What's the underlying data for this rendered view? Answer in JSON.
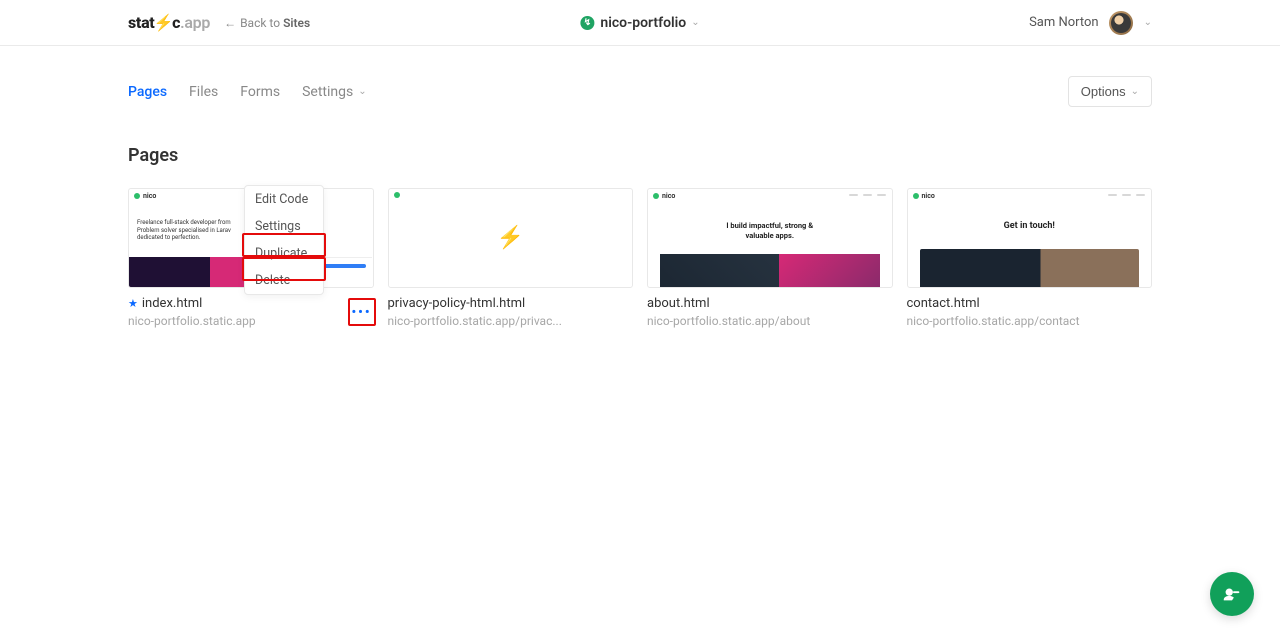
{
  "header": {
    "logo_prefix": "stat",
    "logo_suffix": "c",
    "logo_app": ".app",
    "back_prefix": "Back to",
    "back_target": "Sites",
    "site_name": "nico-portfolio",
    "user_name": "Sam Norton"
  },
  "tabs": {
    "pages": "Pages",
    "files": "Files",
    "forms": "Forms",
    "settings": "Settings"
  },
  "options_label": "Options",
  "section_title": "Pages",
  "context_menu": {
    "edit_code": "Edit Code",
    "settings": "Settings",
    "duplicate": "Duplicate",
    "delete": "Delete"
  },
  "thumbs": {
    "nico": "nico",
    "index_line1": "Freelance full-stack developer from",
    "index_line2": "Problem solver specialised in Larav",
    "index_line3": "dedicated to perfection.",
    "about_line1": "I build impactful, strong &",
    "about_line2": "valuable apps.",
    "contact_line": "Get in touch!"
  },
  "pages": [
    {
      "title": "index.html",
      "url": "nico-portfolio.static.app",
      "starred": true
    },
    {
      "title": "privacy-policy-html.html",
      "url": "nico-portfolio.static.app/privac...",
      "starred": false
    },
    {
      "title": "about.html",
      "url": "nico-portfolio.static.app/about",
      "starred": false
    },
    {
      "title": "contact.html",
      "url": "nico-portfolio.static.app/contact",
      "starred": false
    }
  ]
}
